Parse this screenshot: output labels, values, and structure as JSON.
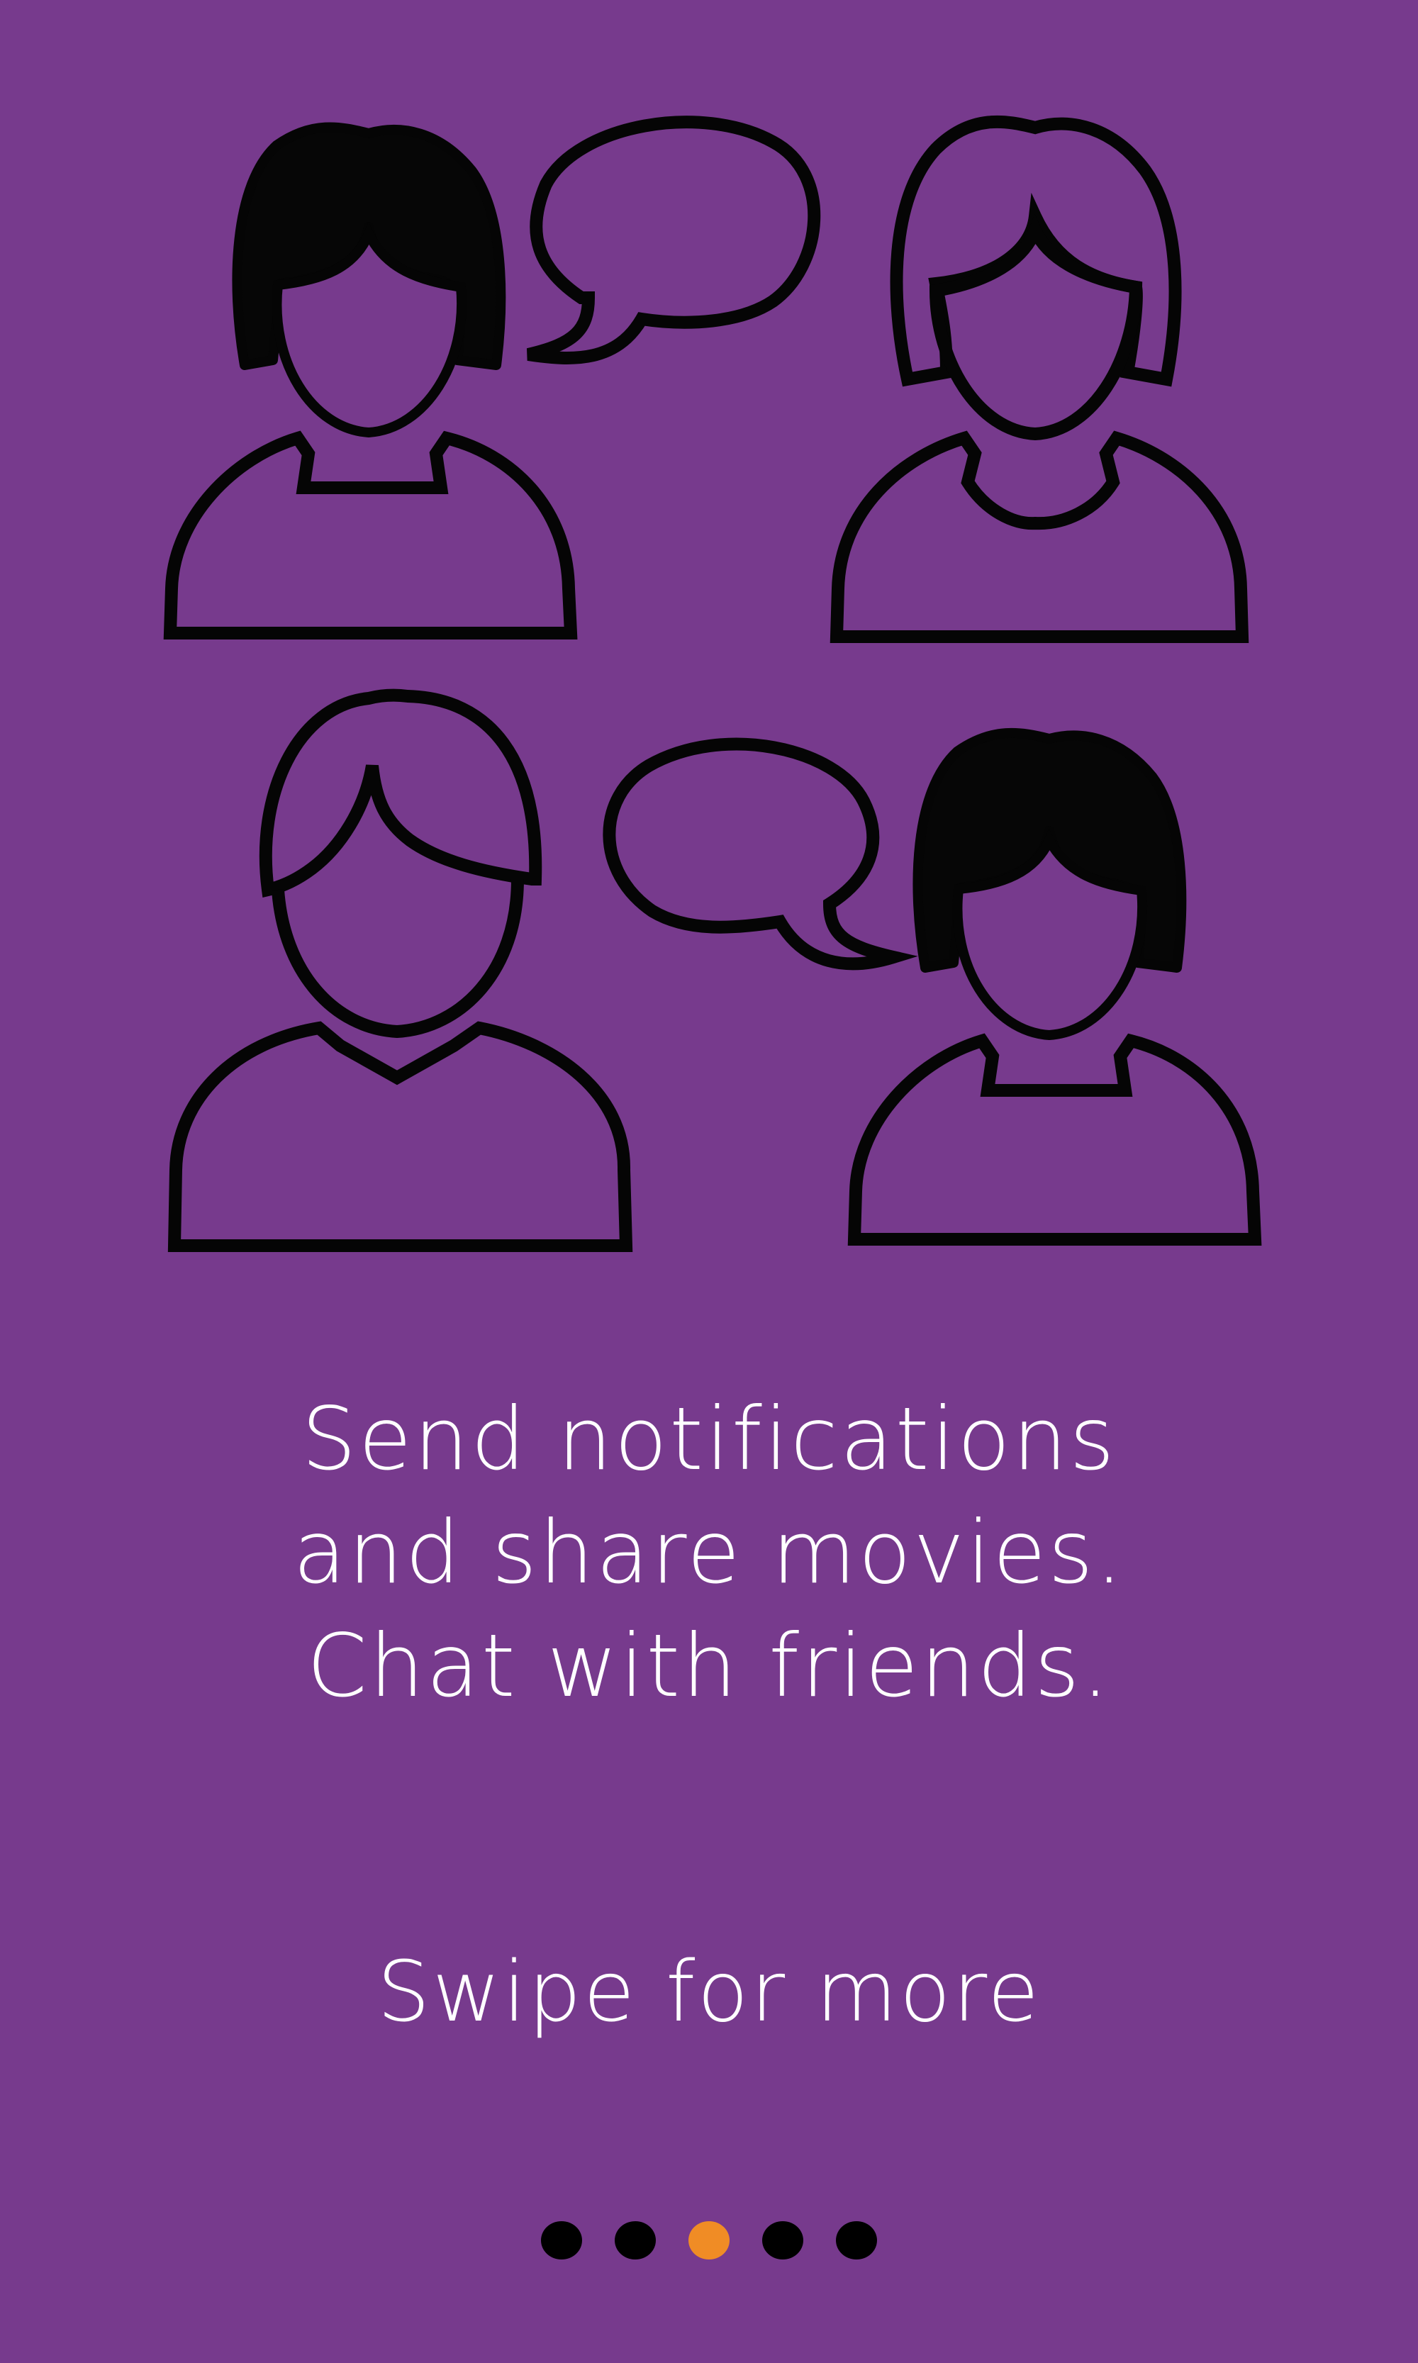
{
  "colors": {
    "background": "#773a8d",
    "text": "#ffffff",
    "pager_dot": "#000000",
    "pager_dot_active": "#f08c25",
    "outline": "#050505"
  },
  "illustration": {
    "icons": [
      "user-woman-short-hair-icon",
      "speech-bubble-icon",
      "user-woman-long-hair-icon",
      "user-man-icon",
      "speech-bubble-icon",
      "user-woman-short-hair-icon"
    ]
  },
  "onboarding": {
    "message_lines": [
      "Send notifications",
      "and share movies.",
      "Chat with friends."
    ],
    "swipe_hint": "Swipe for more"
  },
  "pager": {
    "count": 5,
    "active_index": 2
  }
}
